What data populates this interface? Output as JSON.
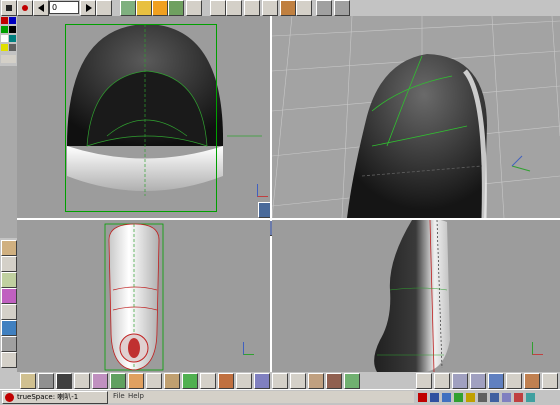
{
  "toolbar": {
    "frame_field_value": "0",
    "icons": [
      "record-icon",
      "play-icon",
      "rewind-icon",
      "stop-icon",
      "move-icon",
      "rotate-icon",
      "scale-icon",
      "paint-icon",
      "select-icon",
      "grid-icon",
      "undo-icon",
      "redo-icon",
      "render-icon",
      "help-icon"
    ]
  },
  "menu": {
    "file_label": "File",
    "help_label": "Help"
  },
  "taskbar": {
    "app_title": "trueSpace: 喇叭-1",
    "time_text": ""
  },
  "colors": {
    "viewport_bg": "#9c9c9c",
    "toolbar_bg": "#c3c3c3",
    "divider": "#ffffff",
    "wire_green": "#00c000",
    "accent_red": "#c00000"
  }
}
